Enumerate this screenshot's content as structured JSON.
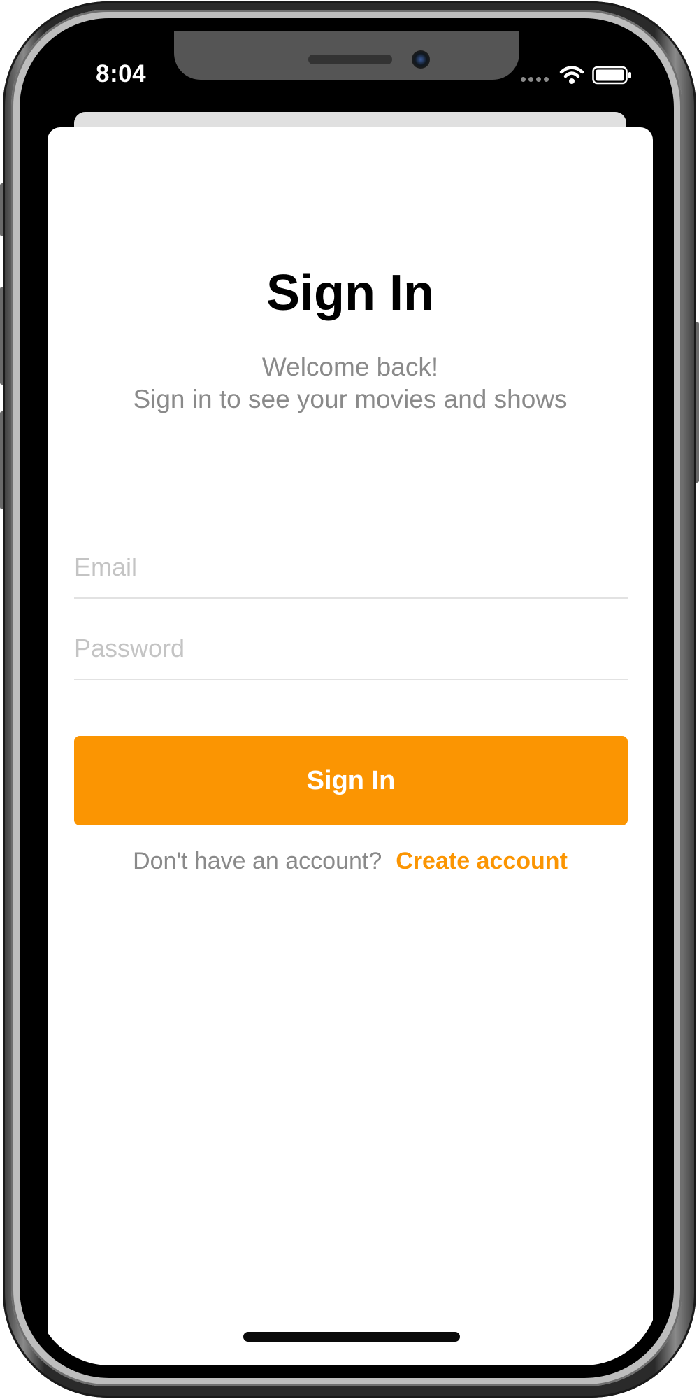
{
  "status_bar": {
    "time": "8:04"
  },
  "sign_in": {
    "title": "Sign In",
    "subtitle_line1": "Welcome back!",
    "subtitle_line2": "Sign in to see your movies and shows",
    "email_placeholder": "Email",
    "email_value": "",
    "password_placeholder": "Password",
    "password_value": "",
    "submit_label": "Sign In",
    "footer_prompt": "Don't have an account?",
    "create_account_label": "Create account"
  },
  "colors": {
    "accent": "#fb9502",
    "subtitle_text": "#8a8a8a",
    "placeholder_text": "#c4c4c4",
    "sheet_background": "#ffffff",
    "frame_background": "#000000"
  },
  "icons": [
    "speaker-grille-icon",
    "front-camera-icon",
    "cellular-signal-icon",
    "wifi-icon",
    "battery-icon"
  ]
}
